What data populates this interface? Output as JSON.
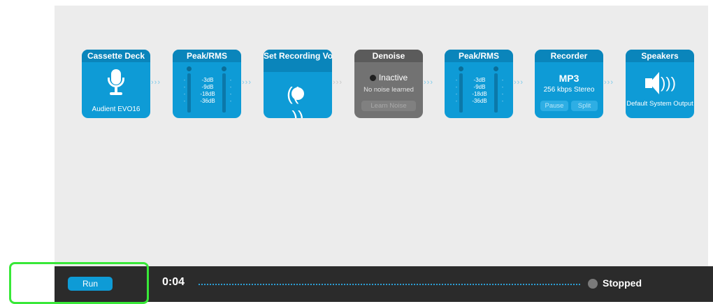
{
  "chain": {
    "cassette": {
      "title": "Cassette Deck",
      "device": "Audient EVO16",
      "icon": "microphone-icon"
    },
    "peak1": {
      "title": "Peak/RMS",
      "levels": [
        "-3dB",
        "-9dB",
        "-18dB",
        "-36dB"
      ]
    },
    "setvolume": {
      "title": "Set Recording Volume",
      "icon": "broadcast-icon"
    },
    "denoise": {
      "title": "Denoise",
      "status": "Inactive",
      "sub": "No noise learned",
      "learn_label": "Learn Noise"
    },
    "peak2": {
      "title": "Peak/RMS",
      "levels": [
        "-3dB",
        "-9dB",
        "-18dB",
        "-36dB"
      ]
    },
    "recorder": {
      "title": "Recorder",
      "format": "MP3",
      "quality": "256 kbps Stereo",
      "pause_label": "Pause",
      "split_label": "Split"
    },
    "speakers": {
      "title": "Speakers",
      "output": "Default System Output",
      "icon": "speaker-icon"
    }
  },
  "bottombar": {
    "run_label": "Run",
    "time": "0:04",
    "status": "Stopped"
  },
  "colors": {
    "accent": "#0e9bd6",
    "header": "#0a85bb",
    "disabled": "#727272",
    "bar": "#2b2b2b",
    "highlight": "#38e838"
  }
}
